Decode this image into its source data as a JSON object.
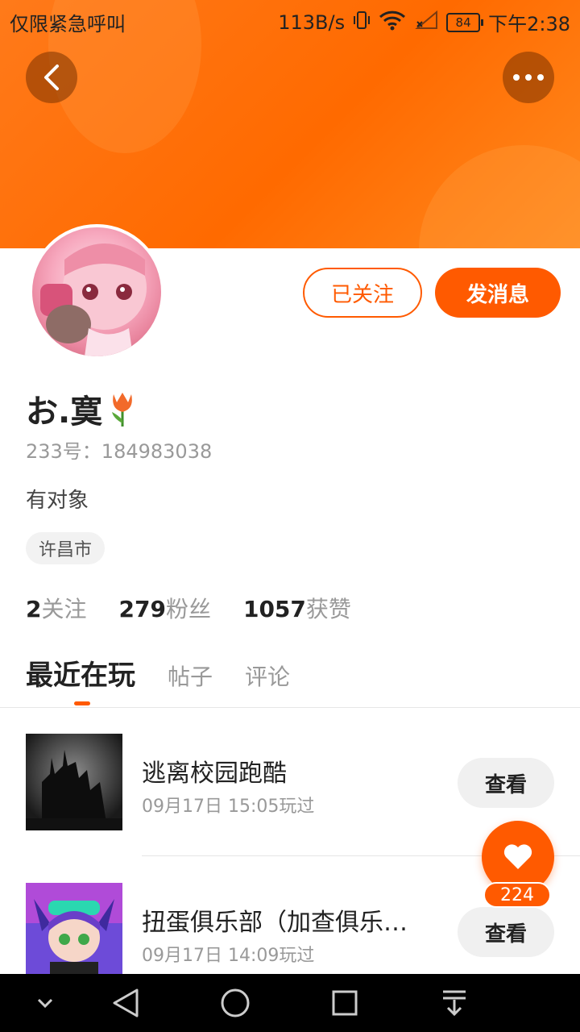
{
  "status_bar": {
    "carrier_text": "仅限紧急呼叫",
    "net_speed": "113B/s",
    "battery": "84",
    "time": "下午2:38"
  },
  "profile": {
    "username": "お.寞",
    "id_line": "233号：184983038",
    "bio": "有对象",
    "location": "许昌市",
    "follow_label": "已关注",
    "message_label": "发消息"
  },
  "stats": {
    "following_count": "2",
    "following_label": "关注",
    "fans_count": "279",
    "fans_label": "粉丝",
    "likes_count": "1057",
    "likes_label": "获赞"
  },
  "tabs": [
    {
      "label": "最近在玩",
      "active": true
    },
    {
      "label": "帖子",
      "active": false
    },
    {
      "label": "评论",
      "active": false
    }
  ],
  "games": [
    {
      "title": "逃离校园跑酷",
      "played": "09月17日 15:05玩过",
      "button": "查看"
    },
    {
      "title": "扭蛋俱乐部（加查俱乐…",
      "played": "09月17日 14:09玩过",
      "button": "查看"
    }
  ],
  "like_fab": {
    "count": "224"
  },
  "colors": {
    "accent": "#ff5a00",
    "banner": "#ff7a1a"
  }
}
